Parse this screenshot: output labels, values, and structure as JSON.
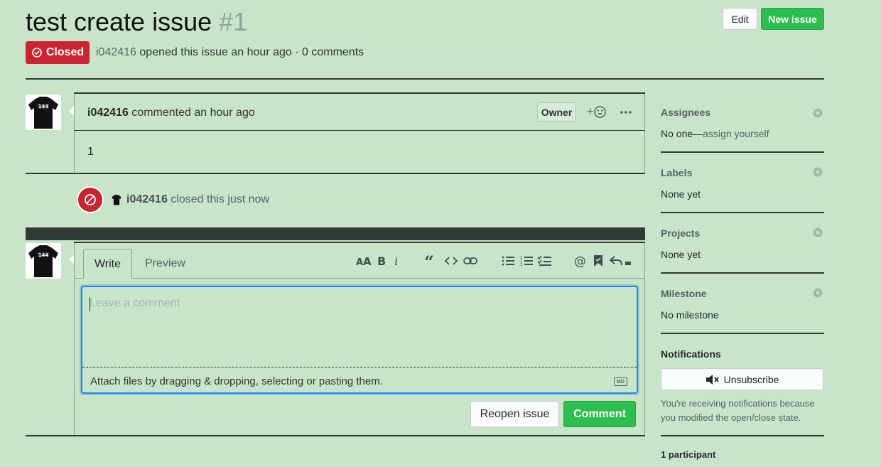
{
  "issue": {
    "title": "test create issue",
    "number": "#1",
    "state": "Closed",
    "author": "i042416",
    "meta_rest": "opened this issue an hour ago · 0 comments"
  },
  "header_buttons": {
    "edit": "Edit",
    "new_issue": "New issue"
  },
  "comment": {
    "author": "i042416",
    "action": "commented an hour ago",
    "badge": "Owner",
    "reaction_plus": "+",
    "body": "1"
  },
  "event": {
    "actor": "i042416",
    "text": "closed this just now"
  },
  "form": {
    "tabs": [
      "Write",
      "Preview"
    ],
    "placeholder": "Leave a comment",
    "attach_text": "Attach files by dragging & dropping, selecting or pasting them.",
    "md_badge": "MD",
    "toolbar": [
      "header-icon",
      "bold-icon",
      "italic-icon",
      "quote-icon",
      "code-icon",
      "link-icon",
      "bullet-list-icon",
      "numbered-list-icon",
      "task-list-icon",
      "mention-icon",
      "saved-reply-icon",
      "reply-icon"
    ],
    "reopen": "Reopen issue",
    "submit": "Comment"
  },
  "sidebar": {
    "assignees": {
      "heading": "Assignees",
      "value": "No one—",
      "link": "assign yourself"
    },
    "labels": {
      "heading": "Labels",
      "value": "None yet"
    },
    "projects": {
      "heading": "Projects",
      "value": "None yet"
    },
    "milestone": {
      "heading": "Milestone",
      "value": "No milestone"
    },
    "notifications": {
      "heading": "Notifications",
      "button": "Unsubscribe",
      "reason": "You're receiving notifications because you modified the open/close state."
    },
    "participants": "1 participant"
  },
  "colors": {
    "background": "#c9e5c9",
    "closed_red": "#cb2431",
    "primary_green": "#2cbe4e",
    "focus_blue": "#2188ff"
  }
}
